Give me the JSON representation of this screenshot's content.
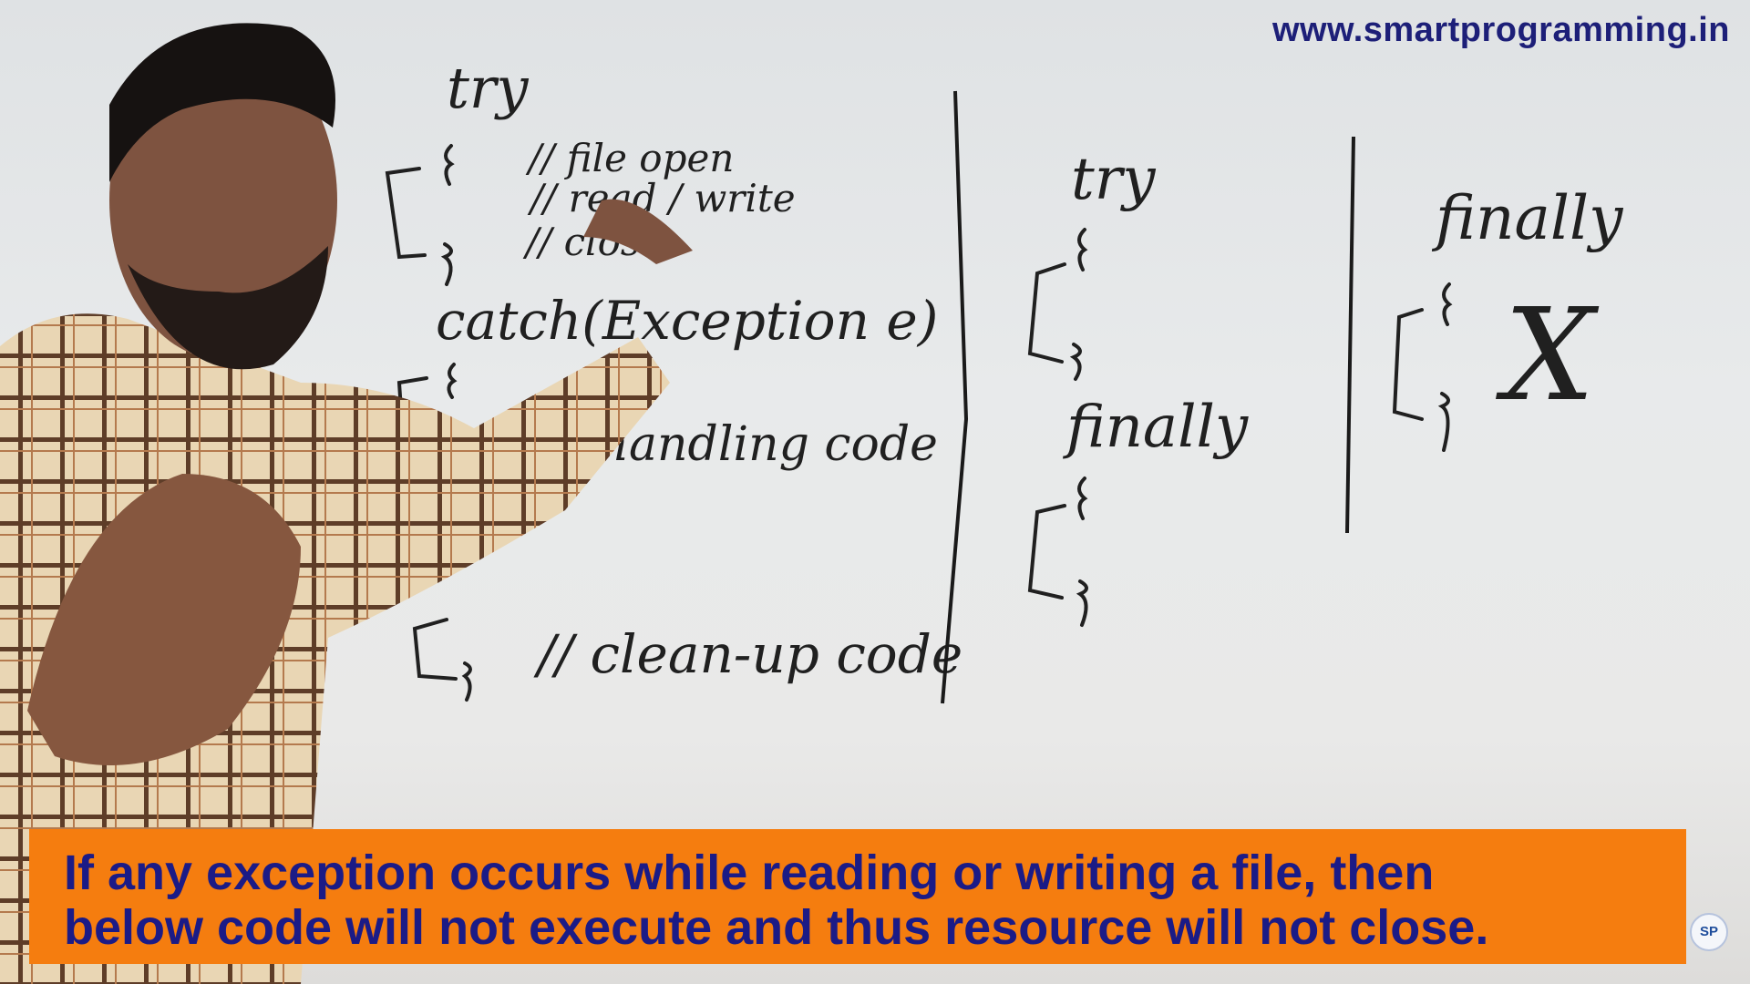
{
  "watermark": "www.smartprogramming.in",
  "board": {
    "col1": {
      "try": "try",
      "c1": "// file open",
      "c2": "// read / write",
      "c3": "// close",
      "catch": "catch(Exception e)",
      "handling": "// handling code",
      "cleanup": "// clean-up code"
    },
    "col2": {
      "try": "try",
      "finally": "finally"
    },
    "col3": {
      "finally": "finally",
      "cross": "X"
    }
  },
  "caption": {
    "line1": "If any exception occurs while reading or writing a file, then",
    "line2": "below code will not execute and thus resource will not close."
  },
  "logo": {
    "text": "SP"
  },
  "colors": {
    "caption_bg": "#f57d0f",
    "caption_text": "#1b1b86",
    "watermark": "#1d1f78",
    "board": "#e6e8e9",
    "ink": "#202020"
  }
}
